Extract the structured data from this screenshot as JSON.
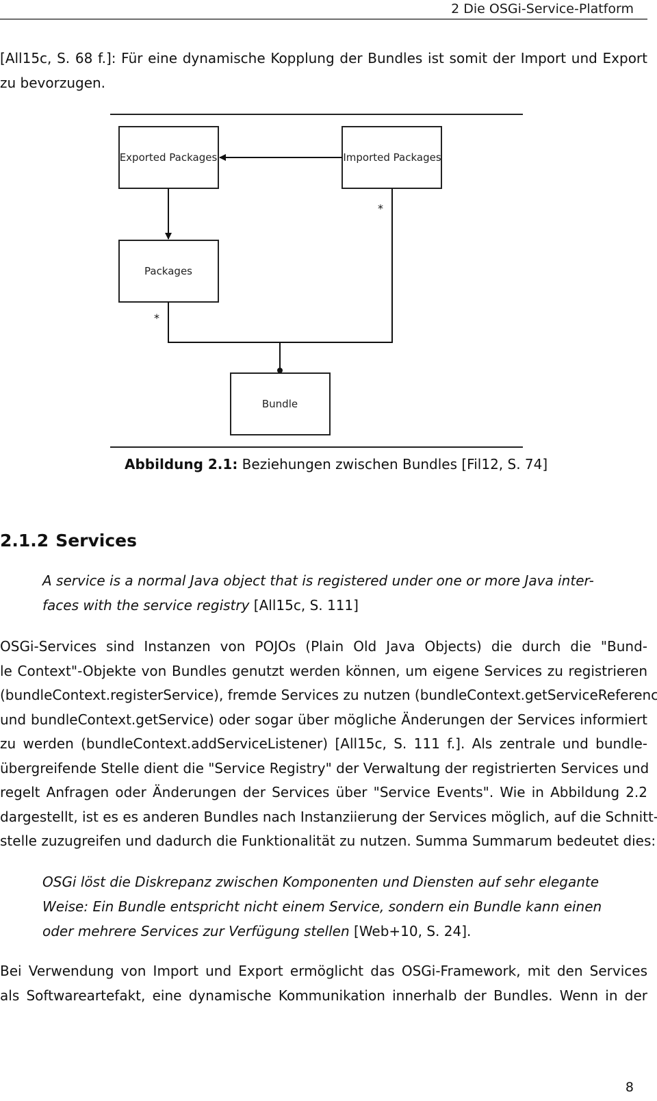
{
  "header": {
    "running_title": "2 Die OSGi-Service-Platform"
  },
  "intro_paragraph": {
    "lines": [
      "[All15c, S. 68 f.]: Für eine dynamische Kopplung der Bundles ist somit der Import und Export",
      "zu bevorzugen."
    ]
  },
  "figure": {
    "boxes": {
      "exported_packages": "Exported Packages",
      "imported_packages": "Imported Packages",
      "packages": "Packages",
      "bundle": "Bundle"
    },
    "multiplicities": {
      "imported": "*",
      "packages": "*"
    },
    "caption": {
      "label": "Abbildung 2.1:",
      "text": " Beziehungen zwischen Bundles [Fil12, S. 74]"
    }
  },
  "section": {
    "number": "2.1.2",
    "title": "Services"
  },
  "quote1": {
    "lines": [
      "A service is a normal Java object that is registered under one or more Java inter-",
      "faces with the service registry"
    ],
    "citation": " [All15c, S. 111]"
  },
  "body_paragraph": {
    "lines": [
      "OSGi-Services sind Instanzen von POJOs (Plain Old Java Objects) die durch die \"Bund-",
      "le Context\"-Objekte von Bundles genutzt werden können, um eigene Services zu registrieren",
      "(bundleContext.registerService), fremde Services zu nutzen (bundleContext.getServiceReference",
      "und bundleContext.getService) oder sogar über mögliche Änderungen der Services informiert",
      "zu werden (bundleContext.addServiceListener) [All15c, S. 111 f.]. Als zentrale und bundle-",
      "übergreifende Stelle dient die \"Service Registry\" der Verwaltung der registrierten Services und",
      "regelt Anfragen oder Änderungen der Services über \"Service Events\". Wie in Abbildung 2.2",
      "dargestellt, ist es es anderen Bundles nach Instanziierung der Services möglich, auf die Schnitt-",
      "stelle zuzugreifen und dadurch die Funktionalität zu nutzen. Summa Summarum bedeutet dies:"
    ]
  },
  "quote2": {
    "lines": [
      "OSGi löst die Diskrepanz zwischen Komponenten und Diensten auf sehr elegante",
      "Weise: Ein Bundle entspricht nicht einem Service, sondern ein Bundle kann einen",
      "oder mehrere Services zur Verfügung stellen"
    ],
    "citation": " [Web+10, S. 24]."
  },
  "closing_paragraph": {
    "lines": [
      "Bei Verwendung von Import und Export ermöglicht das OSGi-Framework, mit den Services",
      "als Softwareartefakt, eine dynamische Kommunikation innerhalb der Bundles. Wenn in der"
    ]
  },
  "footer": {
    "page_number": "8"
  }
}
